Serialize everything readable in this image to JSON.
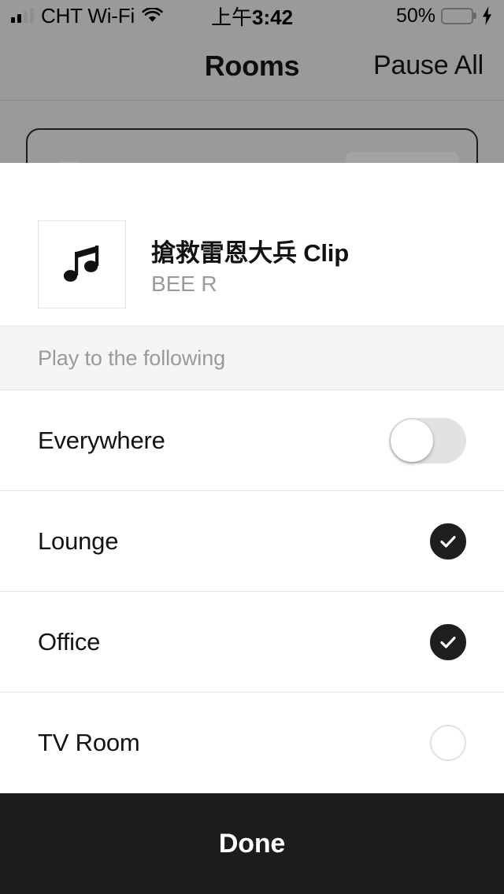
{
  "status_bar": {
    "carrier": "CHT Wi-Fi",
    "signal_icon": "signal-bars-icon",
    "wifi_icon": "wifi-icon",
    "time_period": "上午",
    "time": "3:42",
    "battery_percent": "50%",
    "battery_level": 50,
    "battery_color": "#4cd964",
    "charging_icon": "bolt-icon"
  },
  "nav_bar": {
    "title": "Rooms",
    "action_label": "Pause All"
  },
  "now_playing": {
    "artwork_icon": "music-note-icon",
    "title": "搶救雷恩大兵 Clip",
    "artist": "BEE R"
  },
  "section": {
    "header": "Play to the following"
  },
  "rooms": [
    {
      "label": "Everywhere",
      "control": "toggle",
      "selected": false
    },
    {
      "label": "Lounge",
      "control": "check",
      "selected": true
    },
    {
      "label": "Office",
      "control": "check",
      "selected": true
    },
    {
      "label": "TV Room",
      "control": "check",
      "selected": false
    }
  ],
  "footer": {
    "done_label": "Done"
  },
  "colors": {
    "accent_dark": "#1f1f1f",
    "sheet_background": "#ffffff",
    "backdrop": "#9a9a9a",
    "section_band": "#f5f5f5",
    "separator": "#e5e5e5",
    "done_bar": "#1c1c1c",
    "artist_text": "#9b9b9b"
  }
}
